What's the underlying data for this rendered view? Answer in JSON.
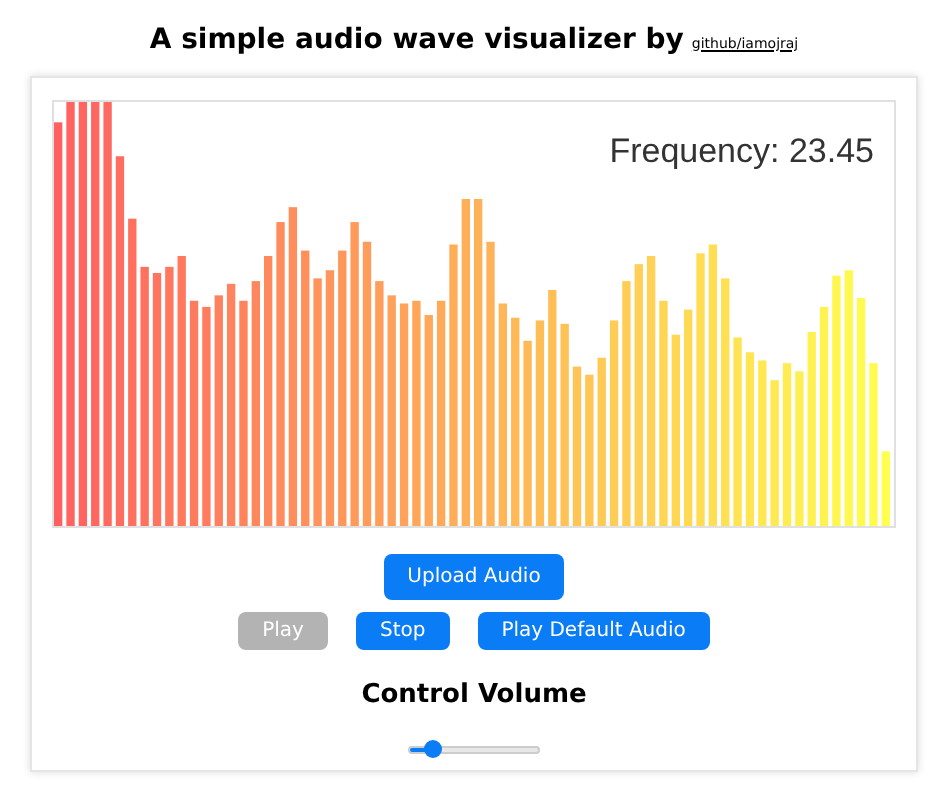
{
  "header": {
    "title": "A simple audio wave visualizer by",
    "link": "github/iamojraj"
  },
  "visualizer": {
    "frequency": "Frequency: 23.45"
  },
  "upload_button": {
    "label": "Upload Audio",
    "disabled": false
  },
  "buttons": [
    {
      "label": "Play",
      "disabled": true
    },
    {
      "label": "Stop",
      "disabled": false
    },
    {
      "label": "Play Default Audio",
      "disabled": false
    }
  ],
  "volume": {
    "label": "Control Volume",
    "level": 0.18
  }
}
